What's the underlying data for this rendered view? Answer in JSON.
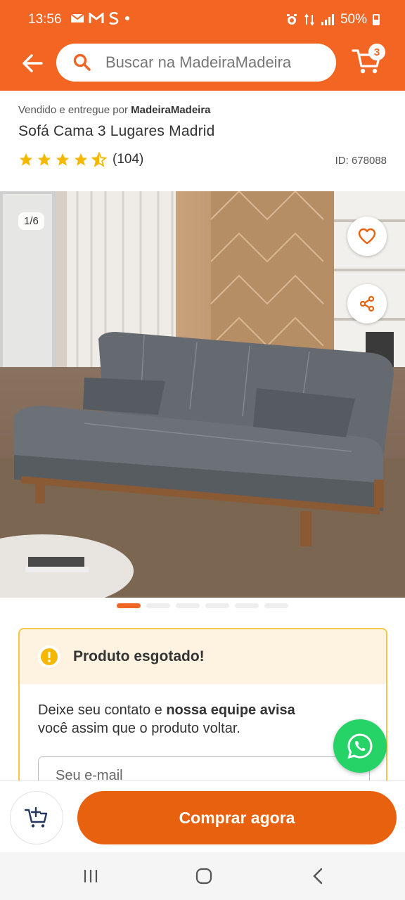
{
  "status_bar": {
    "time": "13:56",
    "left_icons": [
      "mail-icon",
      "gmail-icon",
      "s-icon",
      "dot-icon"
    ],
    "right_icons": [
      "alarm-icon",
      "data-icon",
      "signal-icon"
    ],
    "battery": "50%"
  },
  "header": {
    "search_placeholder": "Buscar na MadeiraMadeira",
    "cart_count": "3",
    "accent_color": "#f26522"
  },
  "product": {
    "seller_prefix": "Vendido e entregue por",
    "seller_name": "MadeiraMadeira",
    "title": "Sofá Cama 3 Lugares Madrid",
    "rating": 4.5,
    "rating_count": "(104)",
    "id_label": "ID: 678088"
  },
  "gallery": {
    "counter": "1/6",
    "total_images": 6,
    "active_index": 0
  },
  "out_of_stock": {
    "title": "Produto esgotado!",
    "text_part1": "Deixe seu contato e",
    "text_bold": "nossa equipe avisa",
    "text_part2": "você assim que o produto voltar.",
    "email_placeholder": "Seu e-mail"
  },
  "actions": {
    "buy_label": "Comprar agora",
    "buy_color": "#e8610f"
  }
}
